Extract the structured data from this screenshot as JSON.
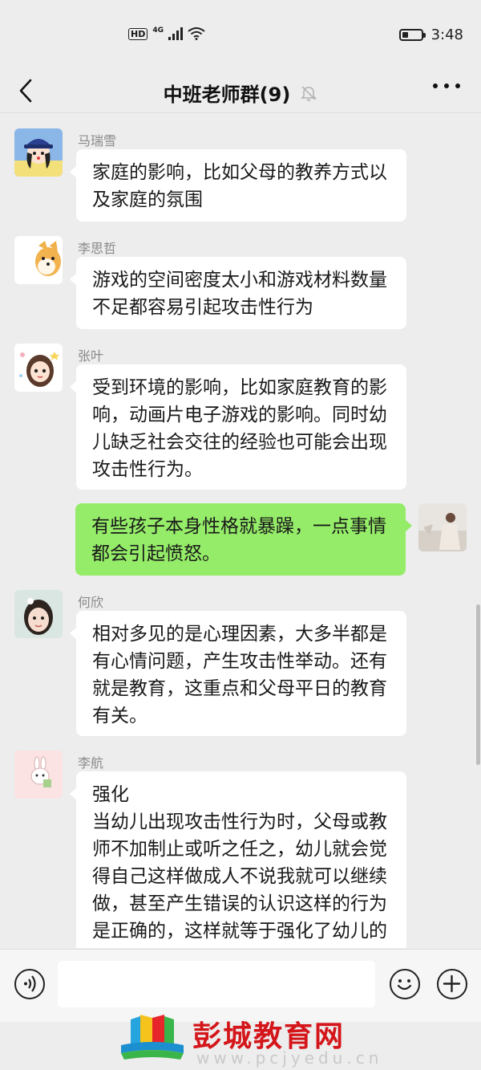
{
  "status_bar": {
    "hd": "HD",
    "network": "4G",
    "time": "3:48"
  },
  "header": {
    "title": "中班老师群(9)"
  },
  "messages": [
    {
      "sender": "马瑞雪",
      "text": "家庭的影响，比如父母的教养方式以及家庭的氛围"
    },
    {
      "sender": "李思哲",
      "text": "游戏的空间密度太小和游戏材料数量不足都容易引起攻击性行为"
    },
    {
      "sender": "张叶",
      "text": "受到环境的影响，比如家庭教育的影响，动画片电子游戏的影响。同时幼儿缺乏社会交往的经验也可能会出现攻击性行为。"
    },
    {
      "sender": "",
      "text": "有些孩子本身性格就暴躁，一点事情都会引起愤怒。"
    },
    {
      "sender": "何欣",
      "text": "相对多见的是心理因素，大多半都是有心情问题，产生攻击性举动。还有就是教育，这重点和父母平日的教育有关。"
    },
    {
      "sender": "李航",
      "text": "强化\n当幼儿出现攻击性行为时，父母或教师不加制止或听之任之，幼儿就会觉得自己这样做成人不说我就可以继续做，甚至产生错误的认识这样的行为是正确的，这样就等于强化了幼儿的攻击性行为，同伴之间"
    }
  ],
  "watermark": {
    "brand": "彭城教育网",
    "url": "www.pcjyedu.cn"
  },
  "colors": {
    "background": "#ededed",
    "bubble_in": "#ffffff",
    "bubble_out": "#95ec69",
    "watermark": "#d4151a"
  }
}
